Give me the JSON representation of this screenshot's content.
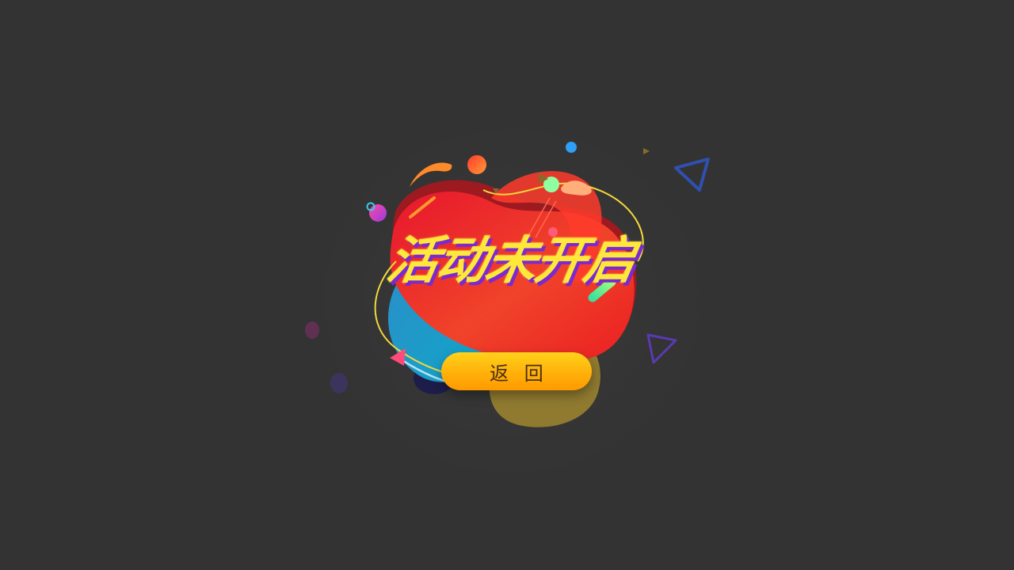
{
  "page": {
    "headline": "活动未开启",
    "back_button_label": "返 回"
  },
  "colors": {
    "background": "#333333",
    "headline": "#ffe83a",
    "headline_shadow": "#7a2ad0",
    "button": "#ffb00a",
    "button_text": "#4a2f12",
    "blob_red": "#ef2a24",
    "blob_blue": "#1f9fd0",
    "blob_olive": "#8f7a30"
  },
  "icons": {
    "outline_triangles": "triangle-outline-icon",
    "small_triangles": "triangle-icon",
    "dots": "dot-icon"
  }
}
